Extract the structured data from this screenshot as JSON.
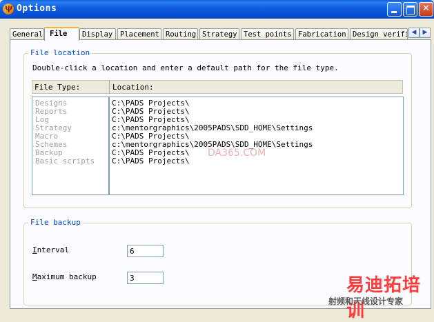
{
  "window": {
    "title": "Options"
  },
  "tabs": [
    "General",
    "File",
    "Display",
    "Placement",
    "Routing",
    "Strategy",
    "Test points",
    "Fabrication",
    "Design verifi"
  ],
  "tab_scroll": {
    "left": "◀",
    "right": "▶"
  },
  "file_location": {
    "title": "File location",
    "instruction": "Double-click a location and enter a default path for the file type.",
    "col_type": "File Type:",
    "col_location": "Location:",
    "types": [
      "Designs",
      "Reports",
      "Log",
      "Strategy",
      "Macro",
      "Schemes",
      "Backup",
      "Basic scripts"
    ],
    "locations": [
      "C:\\PADS Projects\\",
      "C:\\PADS Projects\\",
      "C:\\PADS Projects\\",
      "c:\\mentorgraphics\\2005PADS\\SDD_HOME\\Settings",
      "C:\\PADS Projects\\",
      "c:\\mentorgraphics\\2005PADS\\SDD_HOME\\Settings",
      "C:\\PADS Projects\\",
      "C:\\PADS Projects\\"
    ]
  },
  "file_backup": {
    "title": "File backup",
    "interval_label_u": "I",
    "interval_label_rest": "nterval",
    "interval_value": "6",
    "max_label_u": "M",
    "max_label_rest": "aximum backup",
    "max_value": "3"
  },
  "watermark": {
    "text": "DA365.COM",
    "brand": "易迪拓培训",
    "brand_sub": "射频和天线设计专家"
  }
}
